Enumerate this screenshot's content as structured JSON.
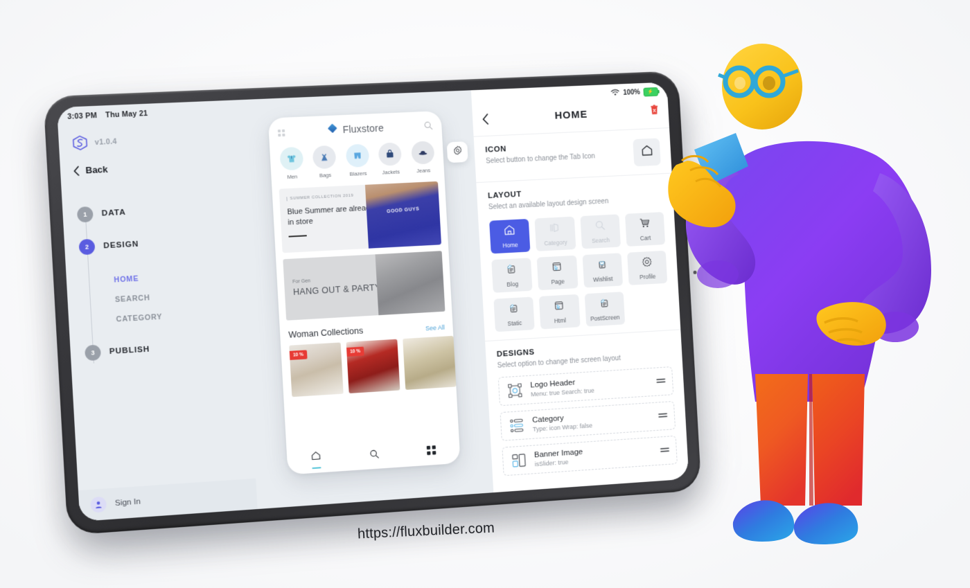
{
  "scene": {
    "site_url": "https://fluxbuilder.com",
    "accent_color": "#4b5ce4",
    "background_color": "#ffffff"
  },
  "tablet": {
    "status_bar": {
      "time": "3:03 PM",
      "date": "Thu May 21"
    }
  },
  "sidebar": {
    "brand": {
      "logo_icon": "flux-cube-logo-icon",
      "version": "v1.0.4"
    },
    "back": {
      "icon": "chevron-left-icon",
      "label": "Back"
    },
    "steps": [
      {
        "number": "1",
        "label": "DATA",
        "active": false
      },
      {
        "number": "2",
        "label": "DESIGN",
        "active": true
      },
      {
        "number": "3",
        "label": "PUBLISH",
        "active": false
      }
    ],
    "design_substeps": [
      {
        "label": "HOME",
        "active": true
      },
      {
        "label": "SEARCH",
        "active": false
      },
      {
        "label": "CATEGORY",
        "active": false
      }
    ],
    "sign_in": {
      "icon": "user-avatar-icon",
      "label": "Sign In"
    }
  },
  "preview": {
    "gear_button_icon": "gear-icon",
    "phone": {
      "header": {
        "menu_icon": "grid-menu-icon",
        "brand_icon": "flux-diamond-icon",
        "brand_name": "Fluxstore",
        "search_icon": "search-icon"
      },
      "categories": [
        {
          "label": "Men",
          "icon": "tshirt-icon"
        },
        {
          "label": "Bags",
          "icon": "dress-icon"
        },
        {
          "label": "Blazers",
          "icon": "shorts-icon"
        },
        {
          "label": "Jackets",
          "icon": "bag-icon"
        },
        {
          "label": "Jeans",
          "icon": "hat-icon"
        }
      ],
      "banner_primary": {
        "kicker": "SUMMER COLLECTION 2019",
        "title": "Blue Summer are already in store"
      },
      "banner_secondary": {
        "kicker": "For Gen",
        "title": "HANG OUT & PARTY"
      },
      "section": {
        "title": "Woman Collections",
        "link": "See All"
      },
      "products": [
        {
          "badge": "10 %"
        },
        {
          "badge": "10 %"
        },
        {
          "badge": ""
        }
      ],
      "nav": [
        {
          "icon": "home-icon",
          "active": true
        },
        {
          "icon": "search-icon",
          "active": false
        },
        {
          "icon": "grid-icon",
          "active": false
        }
      ]
    }
  },
  "right_panel": {
    "status_bar": {
      "wifi_icon": "wifi-icon",
      "battery_percent": "100%",
      "battery_icon": "battery-charging-icon"
    },
    "header": {
      "back_icon": "chevron-left-icon",
      "title": "HOME",
      "delete_icon": "trash-icon"
    },
    "icon_section": {
      "title": "ICON",
      "subtitle": "Select button to change the Tab Icon",
      "button_icon": "home-icon"
    },
    "layout_section": {
      "title": "LAYOUT",
      "subtitle": "Select an available layout design screen",
      "options": [
        {
          "label": "Home",
          "icon": "home-icon",
          "state": "selected"
        },
        {
          "label": "Category",
          "icon": "category-icon",
          "state": "dim"
        },
        {
          "label": "Search",
          "icon": "search-magnifier-icon",
          "state": "dim"
        },
        {
          "label": "Cart",
          "icon": "cart-icon",
          "state": "normal"
        },
        {
          "label": "Blog",
          "icon": "blog-icon",
          "state": "normal"
        },
        {
          "label": "Page",
          "icon": "page-icon",
          "state": "normal"
        },
        {
          "label": "Wishlist",
          "icon": "wishlist-icon",
          "state": "normal"
        },
        {
          "label": "Profile",
          "icon": "profile-gear-icon",
          "state": "normal"
        },
        {
          "label": "Static",
          "icon": "static-icon",
          "state": "normal"
        },
        {
          "label": "Html",
          "icon": "html-icon",
          "state": "normal"
        },
        {
          "label": "PostScreen",
          "icon": "post-screen-icon",
          "state": "normal"
        }
      ]
    },
    "designs_section": {
      "title": "DESIGNS",
      "subtitle": "Select option to change the screen layout",
      "items": [
        {
          "title": "Logo Header",
          "subtitle": "Menu: true  Search: true",
          "icon": "logo-header-icon",
          "drag_icon": "drag-handle-icon"
        },
        {
          "title": "Category",
          "subtitle": "Type: icon  Wrap: false",
          "icon": "category-list-icon",
          "drag_icon": "drag-handle-icon"
        },
        {
          "title": "Banner Image",
          "subtitle": "isSlider: true",
          "icon": "banner-image-icon",
          "drag_icon": "drag-handle-icon"
        }
      ]
    }
  },
  "character": {
    "description": "3d-illustration-person-holding-phone",
    "colors": {
      "head": "#f6c21c",
      "shirt": "#8b3cf0",
      "pants": "#e8452b",
      "shoes": "#2f7de0",
      "glasses": "#2fa8d8",
      "phone": "#3aa0ea"
    }
  }
}
